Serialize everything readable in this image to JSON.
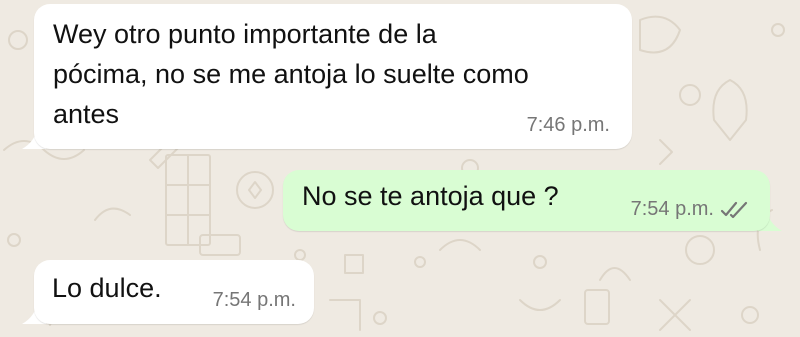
{
  "colors": {
    "wallpaper": "#efeae2",
    "incoming_bubble": "#ffffff",
    "outgoing_bubble": "#d9fdd3",
    "read_receipt": "#767676"
  },
  "messages": [
    {
      "direction": "incoming",
      "text": "Wey otro punto importante de la\npócima, no se me antoja lo suelte como\nantes",
      "time": "7:46 p.m."
    },
    {
      "direction": "outgoing",
      "text": "No se te antoja que ?",
      "time": "7:54 p.m.",
      "status_icon": "double-check-icon"
    },
    {
      "direction": "incoming",
      "text": "Lo dulce.",
      "time": "7:54 p.m."
    }
  ]
}
